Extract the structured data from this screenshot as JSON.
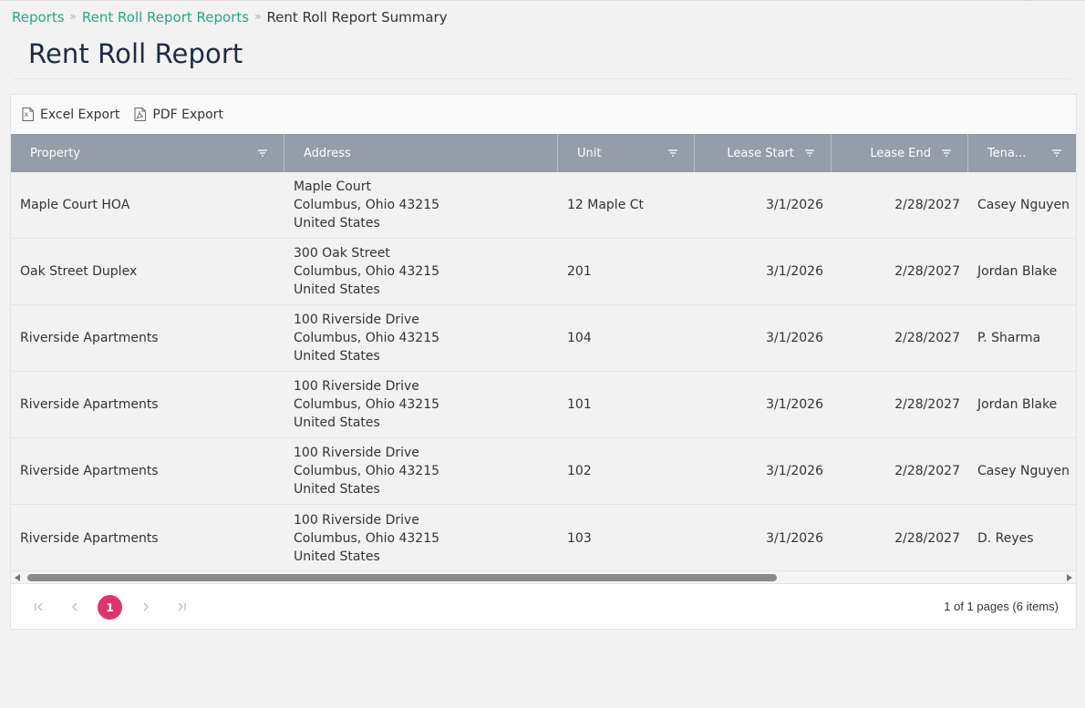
{
  "breadcrumb": {
    "items": [
      "Reports",
      "Rent Roll Report Reports"
    ],
    "current": "Rent Roll Report Summary"
  },
  "page": {
    "title": "Rent Roll Report"
  },
  "toolbar": {
    "excel_label": "Excel Export",
    "pdf_label": "PDF Export"
  },
  "grid": {
    "columns": [
      "Property",
      "Address",
      "Unit",
      "Lease Start",
      "Lease End",
      "Tena..."
    ],
    "rows": [
      {
        "property": "Maple Court HOA",
        "address": [
          "Maple Court",
          "Columbus, Ohio 43215",
          "United States"
        ],
        "unit": "12 Maple Ct",
        "lease_start": "3/1/2026",
        "lease_end": "2/28/2027",
        "tenant": "Casey Nguyen"
      },
      {
        "property": "Oak Street Duplex",
        "address": [
          "300 Oak Street",
          "Columbus, Ohio 43215",
          "United States"
        ],
        "unit": "201",
        "lease_start": "3/1/2026",
        "lease_end": "2/28/2027",
        "tenant": "Jordan Blake"
      },
      {
        "property": "Riverside Apartments",
        "address": [
          "100 Riverside Drive",
          "Columbus, Ohio 43215",
          "United States"
        ],
        "unit": "104",
        "lease_start": "3/1/2026",
        "lease_end": "2/28/2027",
        "tenant": "P. Sharma"
      },
      {
        "property": "Riverside Apartments",
        "address": [
          "100 Riverside Drive",
          "Columbus, Ohio 43215",
          "United States"
        ],
        "unit": "101",
        "lease_start": "3/1/2026",
        "lease_end": "2/28/2027",
        "tenant": "Jordan Blake"
      },
      {
        "property": "Riverside Apartments",
        "address": [
          "100 Riverside Drive",
          "Columbus, Ohio 43215",
          "United States"
        ],
        "unit": "102",
        "lease_start": "3/1/2026",
        "lease_end": "2/28/2027",
        "tenant": "Casey Nguyen"
      },
      {
        "property": "Riverside Apartments",
        "address": [
          "100 Riverside Drive",
          "Columbus, Ohio 43215",
          "United States"
        ],
        "unit": "103",
        "lease_start": "3/1/2026",
        "lease_end": "2/28/2027",
        "tenant": "D. Reyes"
      }
    ]
  },
  "pager": {
    "current_page": "1",
    "info": "1 of 1 pages (6 items)"
  },
  "colors": {
    "accent": "#2aa68a",
    "header_bg": "#959da8",
    "page_active": "#e0336d",
    "title": "#1f2a44"
  }
}
